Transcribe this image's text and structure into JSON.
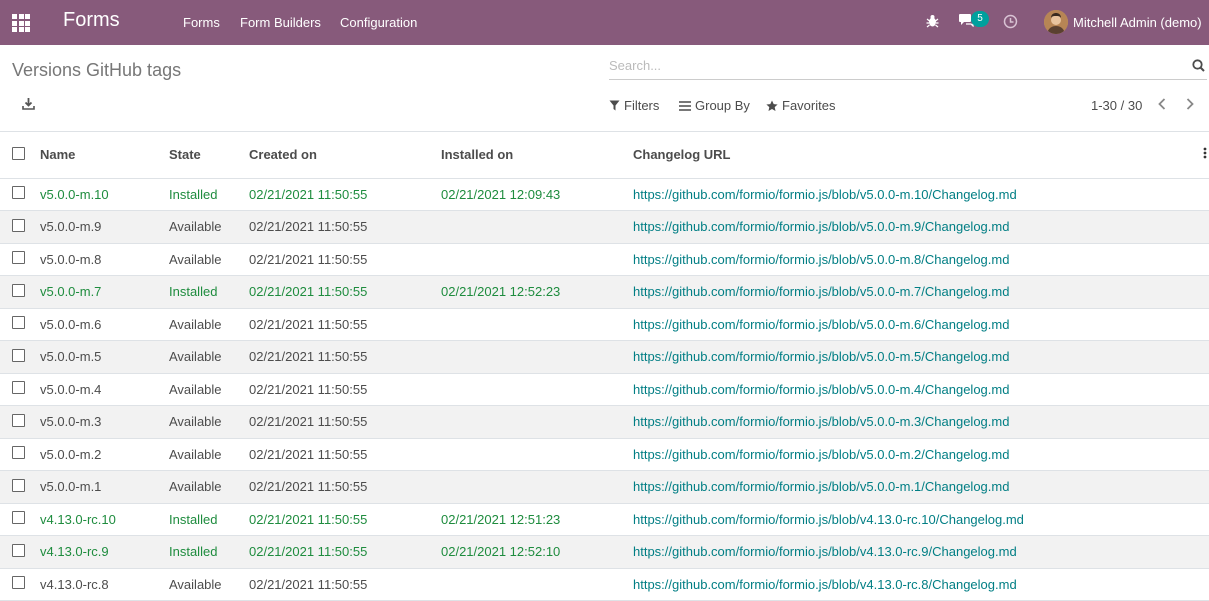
{
  "navbar": {
    "brand": "Forms",
    "menu": [
      "Forms",
      "Form Builders",
      "Configuration"
    ],
    "chat_count": "5",
    "user": "Mitchell Admin (demo)"
  },
  "control_panel": {
    "title": "Versions GitHub tags",
    "search_placeholder": "Search...",
    "filters": "Filters",
    "group_by": "Group By",
    "favorites": "Favorites",
    "pager": "1-30 / 30"
  },
  "table": {
    "columns": [
      "Name",
      "State",
      "Created on",
      "Installed on",
      "Changelog URL"
    ],
    "rows": [
      {
        "name": "v5.0.0-m.10",
        "state": "Installed",
        "created": "02/21/2021 11:50:55",
        "installed": "02/21/2021 12:09:43",
        "url": "https://github.com/formio/formio.js/blob/v5.0.0-m.10/Changelog.md"
      },
      {
        "name": "v5.0.0-m.9",
        "state": "Available",
        "created": "02/21/2021 11:50:55",
        "installed": "",
        "url": "https://github.com/formio/formio.js/blob/v5.0.0-m.9/Changelog.md"
      },
      {
        "name": "v5.0.0-m.8",
        "state": "Available",
        "created": "02/21/2021 11:50:55",
        "installed": "",
        "url": "https://github.com/formio/formio.js/blob/v5.0.0-m.8/Changelog.md"
      },
      {
        "name": "v5.0.0-m.7",
        "state": "Installed",
        "created": "02/21/2021 11:50:55",
        "installed": "02/21/2021 12:52:23",
        "url": "https://github.com/formio/formio.js/blob/v5.0.0-m.7/Changelog.md"
      },
      {
        "name": "v5.0.0-m.6",
        "state": "Available",
        "created": "02/21/2021 11:50:55",
        "installed": "",
        "url": "https://github.com/formio/formio.js/blob/v5.0.0-m.6/Changelog.md"
      },
      {
        "name": "v5.0.0-m.5",
        "state": "Available",
        "created": "02/21/2021 11:50:55",
        "installed": "",
        "url": "https://github.com/formio/formio.js/blob/v5.0.0-m.5/Changelog.md"
      },
      {
        "name": "v5.0.0-m.4",
        "state": "Available",
        "created": "02/21/2021 11:50:55",
        "installed": "",
        "url": "https://github.com/formio/formio.js/blob/v5.0.0-m.4/Changelog.md"
      },
      {
        "name": "v5.0.0-m.3",
        "state": "Available",
        "created": "02/21/2021 11:50:55",
        "installed": "",
        "url": "https://github.com/formio/formio.js/blob/v5.0.0-m.3/Changelog.md"
      },
      {
        "name": "v5.0.0-m.2",
        "state": "Available",
        "created": "02/21/2021 11:50:55",
        "installed": "",
        "url": "https://github.com/formio/formio.js/blob/v5.0.0-m.2/Changelog.md"
      },
      {
        "name": "v5.0.0-m.1",
        "state": "Available",
        "created": "02/21/2021 11:50:55",
        "installed": "",
        "url": "https://github.com/formio/formio.js/blob/v5.0.0-m.1/Changelog.md"
      },
      {
        "name": "v4.13.0-rc.10",
        "state": "Installed",
        "created": "02/21/2021 11:50:55",
        "installed": "02/21/2021 12:51:23",
        "url": "https://github.com/formio/formio.js/blob/v4.13.0-rc.10/Changelog.md"
      },
      {
        "name": "v4.13.0-rc.9",
        "state": "Installed",
        "created": "02/21/2021 11:50:55",
        "installed": "02/21/2021 12:52:10",
        "url": "https://github.com/formio/formio.js/blob/v4.13.0-rc.9/Changelog.md"
      },
      {
        "name": "v4.13.0-rc.8",
        "state": "Available",
        "created": "02/21/2021 11:50:55",
        "installed": "",
        "url": "https://github.com/formio/formio.js/blob/v4.13.0-rc.8/Changelog.md"
      }
    ]
  },
  "colors": {
    "navbar": "#875a7b",
    "installed_text": "#1e8c3e",
    "link": "#017e84",
    "badge": "#00a09d"
  }
}
